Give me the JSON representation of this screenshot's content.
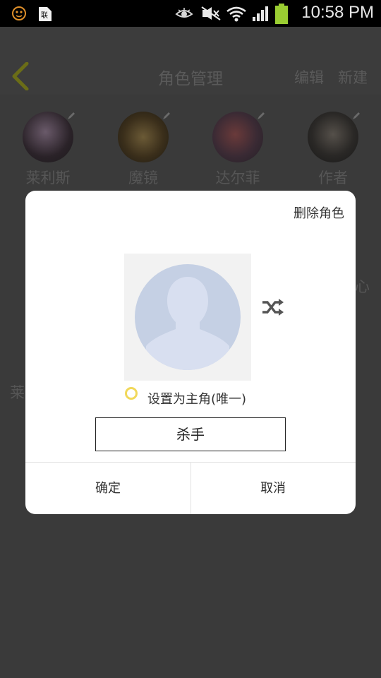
{
  "status_bar": {
    "time": "10:58 PM",
    "icons": [
      "notification-face-icon",
      "sim-card-icon",
      "eye-icon",
      "mute-icon",
      "wifi-icon",
      "signal-icon",
      "battery-icon"
    ]
  },
  "header": {
    "title": "角色管理",
    "edit_label": "编辑",
    "new_label": "新建"
  },
  "characters": [
    {
      "name": "莱利斯"
    },
    {
      "name": "魔镜"
    },
    {
      "name": "达尔菲"
    },
    {
      "name": "作者"
    }
  ],
  "background_fragments": {
    "left_name": "莱",
    "right_char": "心"
  },
  "modal": {
    "delete_label": "删除角色",
    "protagonist_label": "设置为主角(唯一)",
    "protagonist_checked": false,
    "name_value": "杀手",
    "confirm_label": "确定",
    "cancel_label": "取消"
  },
  "colors": {
    "overlay_bg": "#3a3a3a",
    "accent_yellow": "#f1d85a",
    "placeholder_blue": "#c5d0e4"
  }
}
